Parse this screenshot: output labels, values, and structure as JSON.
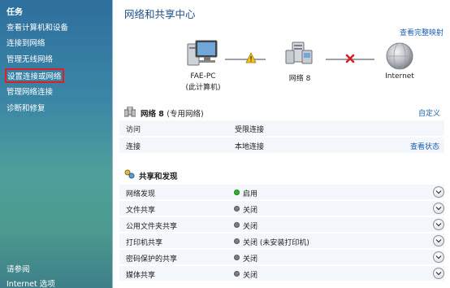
{
  "sidebar": {
    "heading": "任务",
    "items": [
      {
        "label": "查看计算机和设备"
      },
      {
        "label": "连接到网络"
      },
      {
        "label": "管理无线网络"
      },
      {
        "label": "设置连接或网络"
      },
      {
        "label": "管理网络连接"
      },
      {
        "label": "诊断和修复"
      }
    ],
    "see_also_heading": "请参阅",
    "see_also_link": "Internet 选项"
  },
  "main": {
    "title": "网络和共享中心",
    "view_full_map": "查看完整映射",
    "map": {
      "computer": {
        "name": "FAE-PC",
        "caption": "(此计算机)"
      },
      "network": {
        "name": "网络  8"
      },
      "internet": {
        "name": "Internet"
      }
    },
    "network_section": {
      "name": "网络  8",
      "type": "(专用网络)",
      "customize": "自定义",
      "rows": [
        {
          "key": "访问",
          "value": "受限连接",
          "action": ""
        },
        {
          "key": "连接",
          "value": "本地连接",
          "action": "查看状态"
        }
      ]
    },
    "sharing_section": {
      "title": "共享和发现",
      "rows": [
        {
          "key": "网络发现",
          "value": "启用",
          "status": "on"
        },
        {
          "key": "文件共享",
          "value": "关闭",
          "status": "off"
        },
        {
          "key": "公用文件夹共享",
          "value": "关闭",
          "status": "off"
        },
        {
          "key": "打印机共享",
          "value": "关闭 (未安装打印机)",
          "status": "off"
        },
        {
          "key": "密码保护的共享",
          "value": "关闭",
          "status": "off"
        },
        {
          "key": "媒体共享",
          "value": "关闭",
          "status": "off"
        }
      ]
    },
    "colors": {
      "on": "#2db52d",
      "off": "#7a7f86",
      "link": "#1a5fb4",
      "title": "#1e4f8a"
    }
  }
}
